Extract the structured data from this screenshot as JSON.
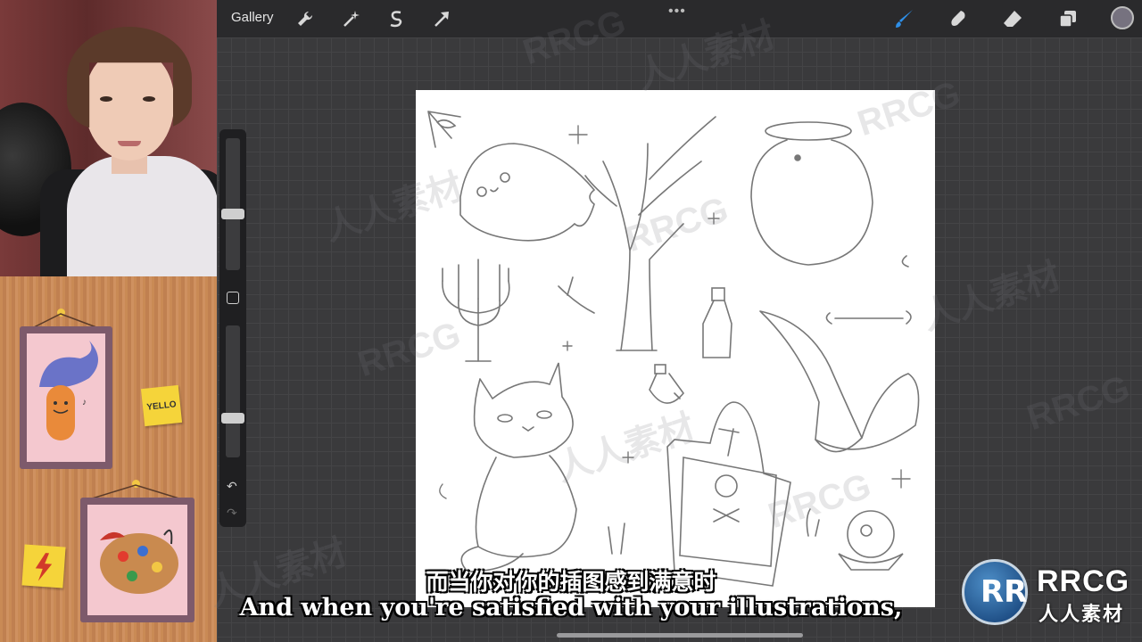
{
  "topbar": {
    "gallery_label": "Gallery",
    "more_dots": "•••",
    "tools_left": [
      "wrench-icon",
      "magic-wand-icon",
      "selection-s-icon",
      "transform-arrow-icon"
    ],
    "tools_right": [
      "brush-icon",
      "smudge-icon",
      "eraser-icon",
      "layers-icon",
      "color-well"
    ],
    "active_color": "#76727f",
    "brush_active_color": "#2e8fe8"
  },
  "sidebar": {
    "size_slider_level": 0.42,
    "opacity_slider_level": 0.28,
    "undo_symbol": "↶",
    "redo_symbol": "↷"
  },
  "board": {
    "sticky_note_text": "YELLO"
  },
  "subtitles": {
    "chinese": "而当你对你的插图感到满意时",
    "english": "And when you're satisfied with your illustrations,"
  },
  "watermark": {
    "brand": "RRCG",
    "chinese": "人人素材"
  },
  "logo": {
    "mark": "RR",
    "brand": "RRCG",
    "chinese": "人人素材"
  }
}
